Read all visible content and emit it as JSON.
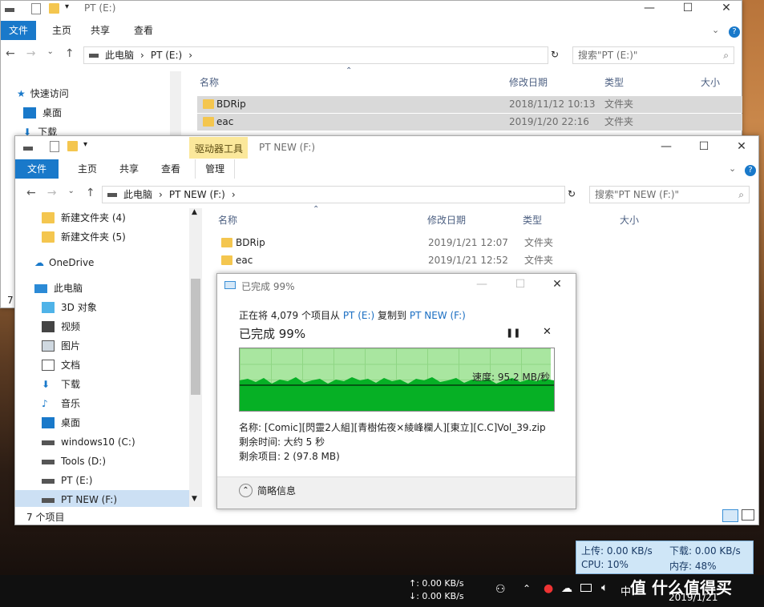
{
  "backWindow": {
    "title": "PT (E:)",
    "tabs": [
      "文件",
      "主页",
      "共享",
      "查看"
    ],
    "path": [
      "此电脑",
      "PT (E:)"
    ],
    "search_placeholder": "搜索\"PT (E:)\"",
    "columns": [
      "名称",
      "修改日期",
      "类型",
      "大小"
    ],
    "rows": [
      {
        "name": "BDRip",
        "date": "2018/11/12 10:13",
        "type": "文件夹"
      },
      {
        "name": "eac",
        "date": "2019/1/20 22:16",
        "type": "文件夹"
      }
    ],
    "sidebar": [
      {
        "label": "快速访问"
      },
      {
        "label": "桌面"
      },
      {
        "label": "下载"
      }
    ],
    "status_fragment": "7"
  },
  "frontWindow": {
    "title": "PT NEW (F:)",
    "context_tab": "驱动器工具",
    "tabs": [
      "文件",
      "主页",
      "共享",
      "查看",
      "管理"
    ],
    "path": [
      "此电脑",
      "PT NEW (F:)"
    ],
    "search_placeholder": "搜索\"PT NEW (F:)\"",
    "columns": [
      "名称",
      "修改日期",
      "类型",
      "大小"
    ],
    "rows": [
      {
        "name": "BDRip",
        "date": "2019/1/21 12:07",
        "type": "文件夹"
      },
      {
        "name": "eac",
        "date": "2019/1/21 12:52",
        "type": "文件夹"
      }
    ],
    "sidebar": [
      {
        "label": "新建文件夹 (4)",
        "icon": "folder-icon"
      },
      {
        "label": "新建文件夹 (5)",
        "icon": "folder-icon"
      },
      {
        "label": "OneDrive",
        "icon": "cloud-icon"
      },
      {
        "label": "此电脑",
        "icon": "computer-icon"
      },
      {
        "label": "3D 对象",
        "icon": "cube-icon"
      },
      {
        "label": "视频",
        "icon": "video-icon"
      },
      {
        "label": "图片",
        "icon": "picture-icon"
      },
      {
        "label": "文档",
        "icon": "document-icon"
      },
      {
        "label": "下载",
        "icon": "download-icon"
      },
      {
        "label": "音乐",
        "icon": "music-icon"
      },
      {
        "label": "桌面",
        "icon": "desktop-icon"
      },
      {
        "label": "windows10 (C:)",
        "icon": "drive-icon"
      },
      {
        "label": "Tools (D:)",
        "icon": "drive-icon"
      },
      {
        "label": "PT (E:)",
        "icon": "drive-icon"
      },
      {
        "label": "PT NEW (F:)",
        "icon": "drive-icon"
      }
    ],
    "status": "7 个项目"
  },
  "copyDialog": {
    "title": "已完成 99%",
    "line_prefix": "正在将 4,079 个项目从",
    "source": "PT (E:)",
    "middle": "复制到",
    "dest": "PT NEW (F:)",
    "progress_text": "已完成 99%",
    "progress_percent": 99,
    "speed": "速度: 95.2 MB/秒",
    "name_label": "名称:",
    "name_value": "[Comic][閃靈2人組][青樹佑夜×綾峰欄人][東立][C.C]Vol_39.zip",
    "remaining_time": "剩余时间: 大约 5 秒",
    "remaining_items": "剩余项目: 2 (97.8 MB)",
    "details_toggle": "简略信息"
  },
  "netMonitor": {
    "up": "上传: 0.00 KB/s",
    "down": "下载: 0.00 KB/s",
    "cpu": "CPU: 10%",
    "mem": "内存: 48%"
  },
  "taskbar": {
    "up_speed": "0.00 KB/s",
    "down_speed": "0.00 KB/s",
    "ime": "中",
    "date": "2019/1/21",
    "watermark": "值 什么值得买"
  },
  "colors": {
    "accent": "#1979ca",
    "progress_fill": "#06b025",
    "progress_bg": "#a9e6a0",
    "context_tab": "#fbe89b"
  }
}
